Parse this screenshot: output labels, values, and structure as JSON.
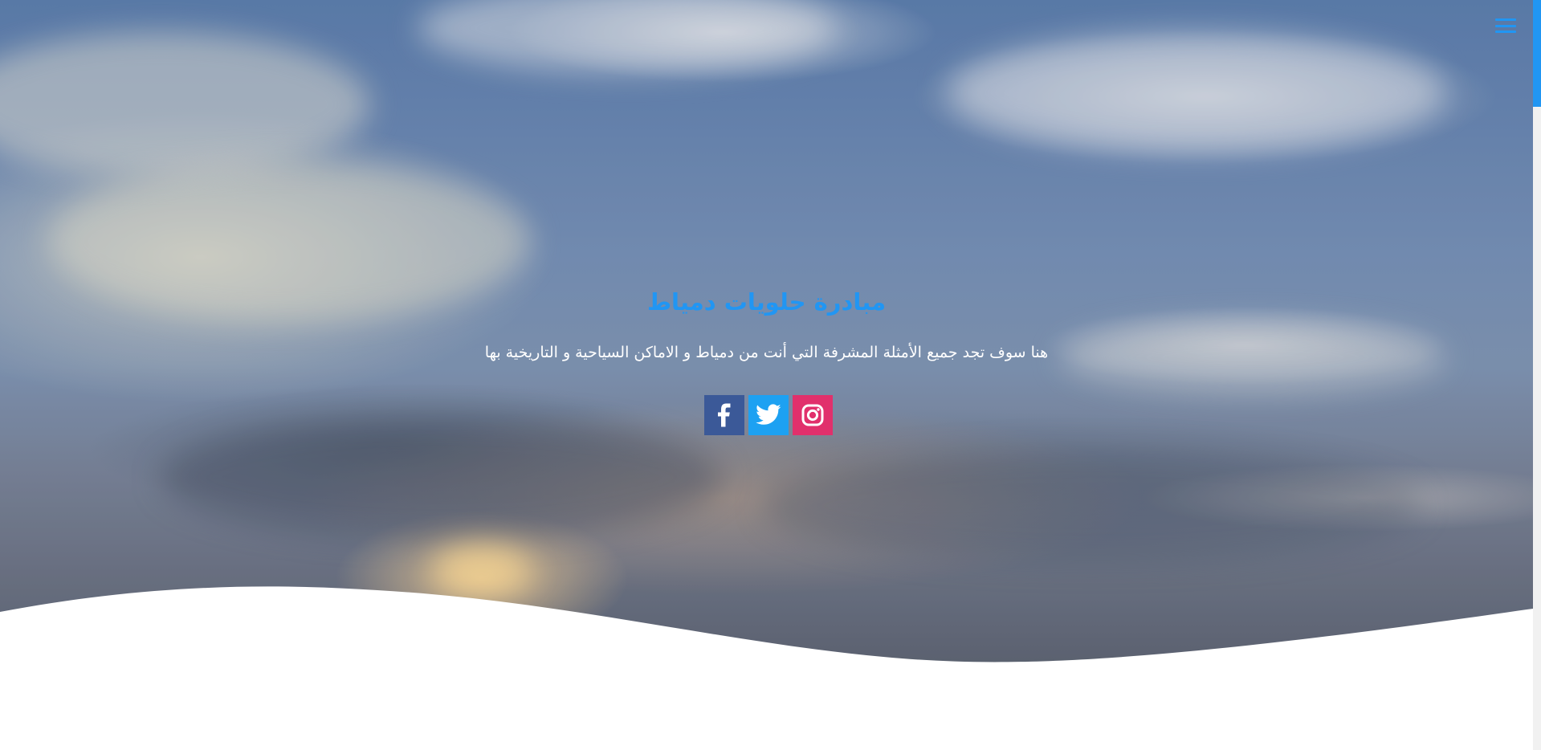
{
  "hero": {
    "title": "مبادرة حلويات دمياط",
    "subtitle": "هنا سوف تجد جميع الأمثلة المشرفة التي أنت من دمياط و الاماكن السياحية و التاريخية بها"
  },
  "nav": {
    "menu_icon": "hamburger-menu-icon"
  },
  "social": {
    "items": [
      {
        "name": "facebook",
        "icon": "facebook-icon",
        "color": "#3b5998"
      },
      {
        "name": "twitter",
        "icon": "twitter-icon",
        "color": "#1da1f2"
      },
      {
        "name": "instagram",
        "icon": "instagram-icon",
        "color": "#e1306c"
      }
    ]
  },
  "colors": {
    "accent": "#2196f3",
    "subtitle_text": "#ffffff",
    "background": "#ffffff"
  }
}
